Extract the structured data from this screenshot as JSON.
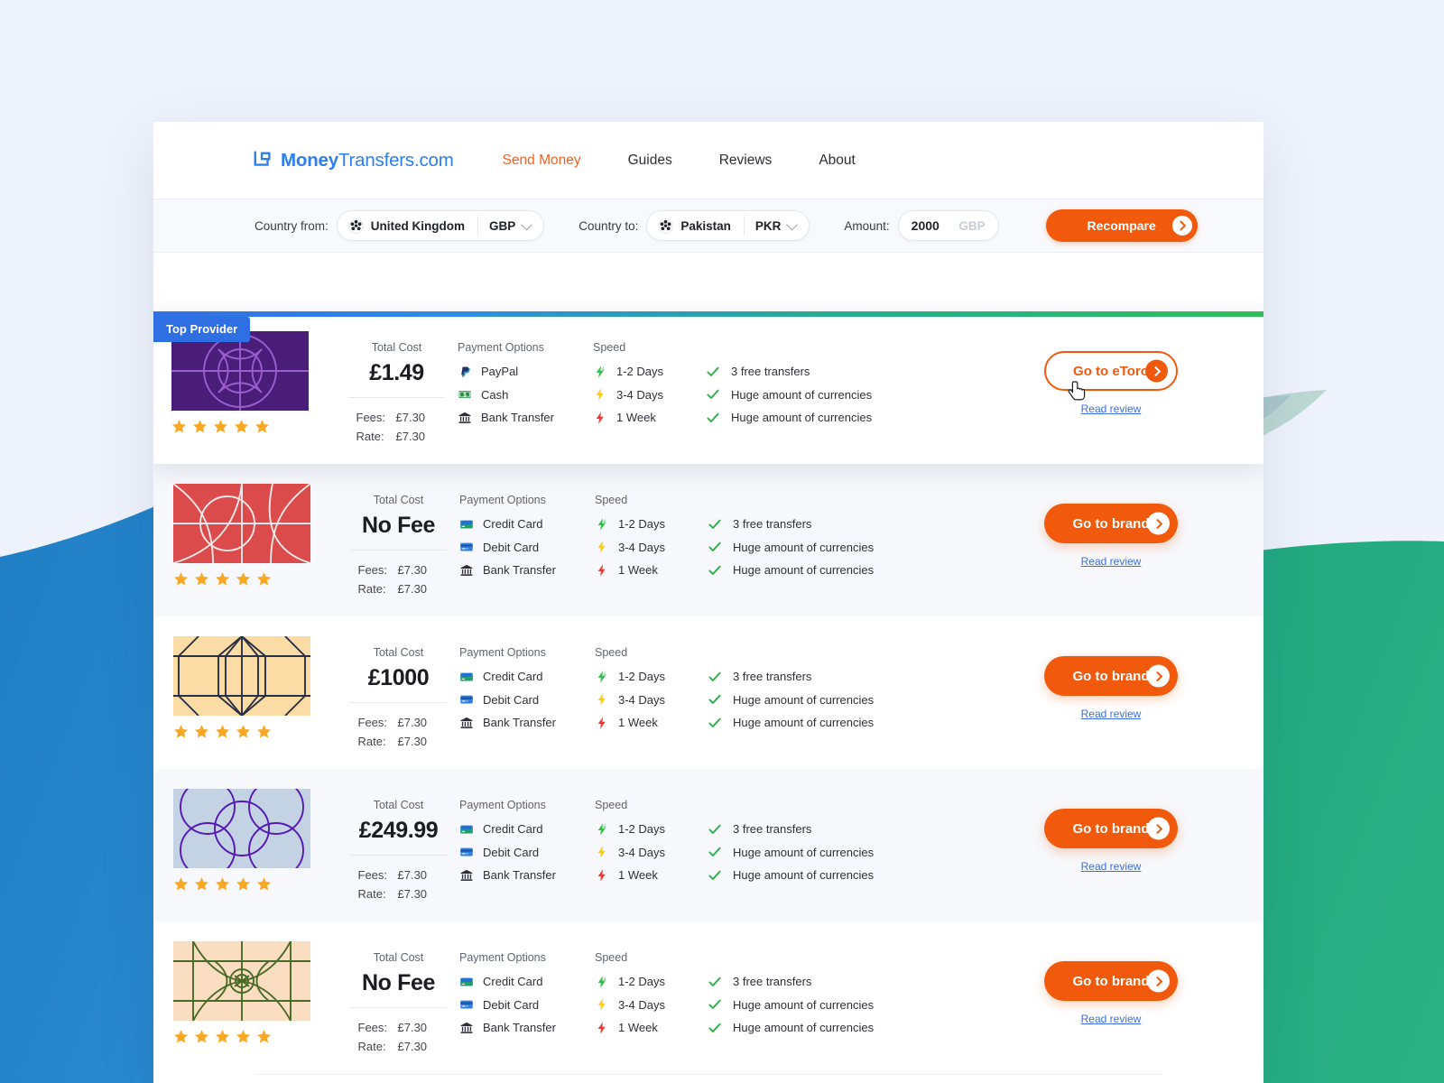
{
  "header": {
    "logo_text_bold": "Money",
    "logo_text_light": "Transfers.com",
    "logo_icon": "bracket-square-icon",
    "nav": [
      {
        "label": "Send Money",
        "active": true
      },
      {
        "label": "Guides",
        "active": false
      },
      {
        "label": "Reviews",
        "active": false
      },
      {
        "label": "About",
        "active": false
      }
    ]
  },
  "search": {
    "country_from_label": "Country from:",
    "country_from_value": "United Kingdom",
    "currency_from": "GBP",
    "country_to_label": "Country to:",
    "country_to_value": "Pakistan",
    "currency_to": "PKR",
    "amount_label": "Amount:",
    "amount_value": "2000",
    "amount_currency": "GBP",
    "recompare_label": "Recompare"
  },
  "columns": {
    "total_cost": "Total Cost",
    "payment_options": "Payment Options",
    "speed": "Speed",
    "fees_label": "Fees:",
    "rate_label": "Rate:"
  },
  "badges": {
    "top_provider": "Top Provider"
  },
  "colors": {
    "accent_orange": "#f15a0c",
    "link_blue": "#3b6fe0",
    "badge_blue": "#2f6fe4",
    "gradient_start": "#2f6fe4",
    "gradient_end": "#2fbf5a",
    "star_gold": "#f9a825",
    "check_green": "#2eaf48"
  },
  "rows": [
    {
      "featured": true,
      "tile_bg": "#4a1e78",
      "tile_line": "#9a5ed0",
      "tile_pattern": "circles-star",
      "rating": 5,
      "total_cost": "£1.49",
      "fees": "£7.30",
      "rate": "£7.30",
      "payments": [
        {
          "label": "PayPal",
          "icon": "paypal-icon"
        },
        {
          "label": "Cash",
          "icon": "cash-icon"
        },
        {
          "label": "Bank Transfer",
          "icon": "bank-icon"
        }
      ],
      "speeds": [
        {
          "label": "1-2 Days",
          "icon": "bolt-green-icon"
        },
        {
          "label": "3-4 Days",
          "icon": "bolt-yellow-icon"
        },
        {
          "label": "1 Week",
          "icon": "bolt-red-icon"
        }
      ],
      "features": [
        "3 free transfers",
        "Huge amount of currencies",
        "Huge amount of currencies"
      ],
      "cta_label": "Go to eToro",
      "cta_style": "outline",
      "review_label": "Read review"
    },
    {
      "featured": false,
      "tile_bg": "#dc4b4b",
      "tile_line": "#fbe9e9",
      "tile_pattern": "arcs-grid",
      "rating": 5,
      "total_cost": "No Fee",
      "fees": "£7.30",
      "rate": "£7.30",
      "payments": [
        {
          "label": "Credit Card",
          "icon": "credit-card-icon"
        },
        {
          "label": "Debit Card",
          "icon": "debit-card-icon"
        },
        {
          "label": "Bank Transfer",
          "icon": "bank-icon"
        }
      ],
      "speeds": [
        {
          "label": "1-2 Days",
          "icon": "bolt-green-icon"
        },
        {
          "label": "3-4 Days",
          "icon": "bolt-yellow-icon"
        },
        {
          "label": "1 Week",
          "icon": "bolt-red-icon"
        }
      ],
      "features": [
        "3 free transfers",
        "Huge amount of currencies",
        "Huge amount of currencies"
      ],
      "cta_label": "Go to brand",
      "cta_style": "solid",
      "review_label": "Read review"
    },
    {
      "featured": false,
      "tile_bg": "#fbdca5",
      "tile_line": "#2b2f45",
      "tile_pattern": "hexagons",
      "rating": 5,
      "total_cost": "£1000",
      "fees": "£7.30",
      "rate": "£7.30",
      "payments": [
        {
          "label": "Credit Card",
          "icon": "credit-card-icon"
        },
        {
          "label": "Debit Card",
          "icon": "debit-card-icon"
        },
        {
          "label": "Bank Transfer",
          "icon": "bank-icon"
        }
      ],
      "speeds": [
        {
          "label": "1-2 Days",
          "icon": "bolt-green-icon"
        },
        {
          "label": "3-4 Days",
          "icon": "bolt-yellow-icon"
        },
        {
          "label": "1 Week",
          "icon": "bolt-red-icon"
        }
      ],
      "features": [
        "3 free transfers",
        "Huge amount of currencies",
        "Huge amount of currencies"
      ],
      "cta_label": "Go to brand",
      "cta_style": "solid",
      "review_label": "Read review"
    },
    {
      "featured": false,
      "tile_bg": "#c3d3e3",
      "tile_line": "#5618b4",
      "tile_pattern": "circles",
      "rating": 5,
      "total_cost": "£249.99",
      "fees": "£7.30",
      "rate": "£7.30",
      "payments": [
        {
          "label": "Credit Card",
          "icon": "credit-card-icon"
        },
        {
          "label": "Debit Card",
          "icon": "debit-card-icon"
        },
        {
          "label": "Bank Transfer",
          "icon": "bank-icon"
        }
      ],
      "speeds": [
        {
          "label": "1-2 Days",
          "icon": "bolt-green-icon"
        },
        {
          "label": "3-4 Days",
          "icon": "bolt-yellow-icon"
        },
        {
          "label": "1 Week",
          "icon": "bolt-red-icon"
        }
      ],
      "features": [
        "3 free transfers",
        "Huge amount of currencies",
        "Huge amount of currencies"
      ],
      "cta_label": "Go to brand",
      "cta_style": "solid",
      "review_label": "Read review"
    },
    {
      "featured": false,
      "tile_bg": "#fbddc2",
      "tile_line": "#4a6b26",
      "tile_pattern": "eye",
      "rating": 5,
      "total_cost": "No Fee",
      "fees": "£7.30",
      "rate": "£7.30",
      "payments": [
        {
          "label": "Credit Card",
          "icon": "credit-card-icon"
        },
        {
          "label": "Debit Card",
          "icon": "debit-card-icon"
        },
        {
          "label": "Bank Transfer",
          "icon": "bank-icon"
        }
      ],
      "speeds": [
        {
          "label": "1-2 Days",
          "icon": "bolt-green-icon"
        },
        {
          "label": "3-4 Days",
          "icon": "bolt-yellow-icon"
        },
        {
          "label": "1 Week",
          "icon": "bolt-red-icon"
        }
      ],
      "features": [
        "3 free transfers",
        "Huge amount of currencies",
        "Huge amount of currencies"
      ],
      "cta_label": "Go to brand",
      "cta_style": "solid",
      "review_label": "Read review"
    }
  ]
}
